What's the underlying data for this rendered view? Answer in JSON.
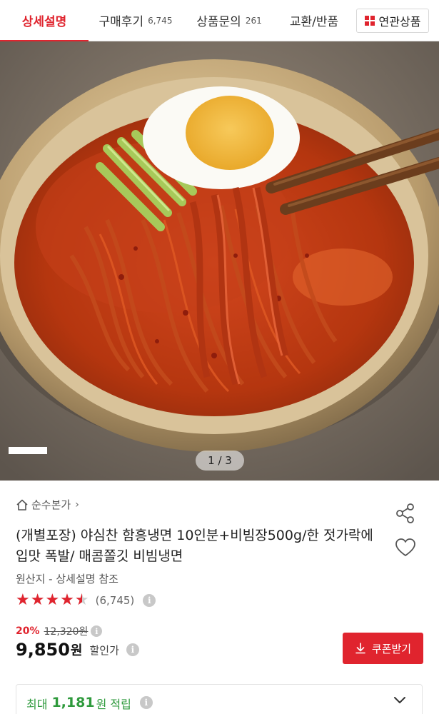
{
  "tabs": [
    {
      "label": "상세설명",
      "count": ""
    },
    {
      "label": "구매후기",
      "count": "6,745"
    },
    {
      "label": "상품문의",
      "count": "261"
    },
    {
      "label": "교환/반품",
      "count": ""
    }
  ],
  "related_button": {
    "label": "연관상품"
  },
  "gallery": {
    "indicator": "1 / 3"
  },
  "product": {
    "brand": "순수본가",
    "title": "(개별포장) 야심찬 함흥냉면 10인분+비빔장500g/한 젓가락에 입맛 폭발/ 매콤쫄깃 비빔냉면",
    "origin": "원산지 - 상세설명 참조",
    "rating": 4.5,
    "review_count": "(6,745)",
    "stars_text": "★★★★★"
  },
  "pricing": {
    "discount_rate": "20%",
    "original_price": "12,320원",
    "price": "9,850",
    "currency": "원",
    "after_discount_label": "할인가"
  },
  "coupon": {
    "label": "쿠폰받기"
  },
  "points": {
    "prefix": "최대",
    "amount": "1,181",
    "suffix": "원 적립"
  },
  "colors": {
    "accent": "#e0242e",
    "points": "#2e9a3c"
  },
  "icons": [
    "home-icon",
    "chevron-right-icon",
    "share-icon",
    "heart-icon",
    "info-icon",
    "download-icon",
    "chevron-down-icon",
    "grid-icon"
  ]
}
